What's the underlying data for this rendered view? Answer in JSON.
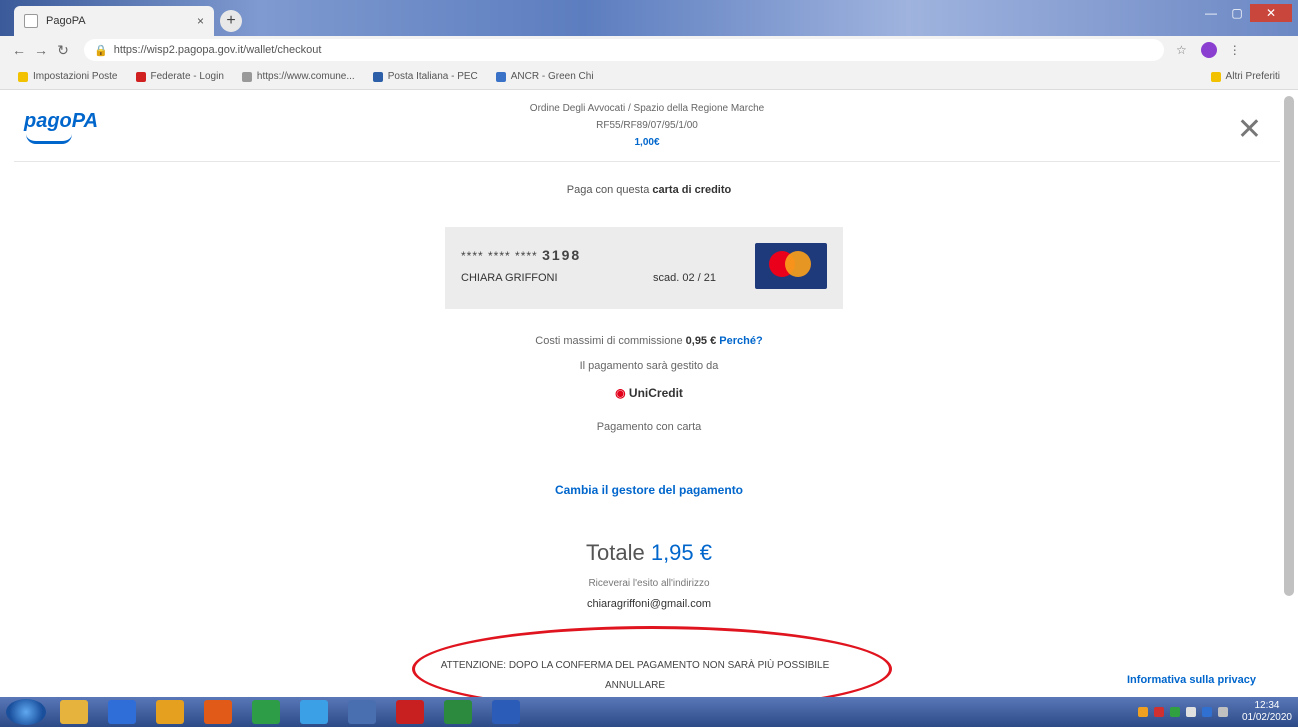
{
  "browser": {
    "tab_title": "PagoPA",
    "tab_close": "×",
    "new_tab": "+",
    "url": "https://wisp2.pagopa.gov.it/wallet/checkout",
    "bookmarks": [
      {
        "label": "Impostazioni Poste",
        "color": "#f2c200"
      },
      {
        "label": "Federate - Login",
        "color": "#d02020"
      },
      {
        "label": "https://www.comune...",
        "color": "#999999"
      },
      {
        "label": "Posta Italiana - PEC",
        "color": "#2d5fa8"
      },
      {
        "label": "ANCR - Green Chi",
        "color": "#3a72c8"
      }
    ],
    "other_bookmarks": "Altri Preferiti"
  },
  "header": {
    "logo": "pagoPA",
    "merchant": "Ordine Degli Avvocati / Spazio della Regione Marche",
    "reference": "RF55/RF89/07/95/1/00",
    "amount": "1,00€"
  },
  "payment": {
    "pay_with_prefix": "Paga con questa",
    "pay_with_bold": "carta di credito",
    "card": {
      "masked": "**** **** ****",
      "last4": "3198",
      "holder": "CHIARA GRIFFONI",
      "expiry": "scad. 02 / 21"
    },
    "commission_prefix": "Costi massimi di commissione",
    "commission_value": "0,95 €",
    "why_link": "Perché?",
    "managed_by": "Il pagamento sarà gestito da",
    "psp": "UniCredit",
    "method": "Pagamento con carta",
    "change_manager": "Cambia il gestore del pagamento",
    "total_label": "Totale",
    "total_amount": "1,95 €",
    "receipt_label": "Riceverai l'esito all'indirizzo",
    "email": "chiaragriffoni@gmail.com",
    "warning": "ATTENZIONE: DOPO LA CONFERMA DEL PAGAMENTO NON SARÀ PIÙ POSSIBILE ANNULLARE",
    "privacy": "Informativa sulla privacy"
  },
  "taskbar": {
    "clock_time": "12:34",
    "clock_date": "01/02/2020",
    "icons": [
      {
        "name": "explorer-icon",
        "color": "#e6b33c"
      },
      {
        "name": "media-icon",
        "color": "#2f6ed8"
      },
      {
        "name": "folder-icon",
        "color": "#e6a020"
      },
      {
        "name": "firefox-icon",
        "color": "#e25a18"
      },
      {
        "name": "chrome-icon",
        "color": "#2e9d47"
      },
      {
        "name": "ie-icon",
        "color": "#3ba0e6"
      },
      {
        "name": "network-icon",
        "color": "#4a6fb0"
      },
      {
        "name": "pdf-icon",
        "color": "#c82020"
      },
      {
        "name": "excel-icon",
        "color": "#2b8a3e"
      },
      {
        "name": "word-icon",
        "color": "#2b5cb8"
      }
    ]
  }
}
